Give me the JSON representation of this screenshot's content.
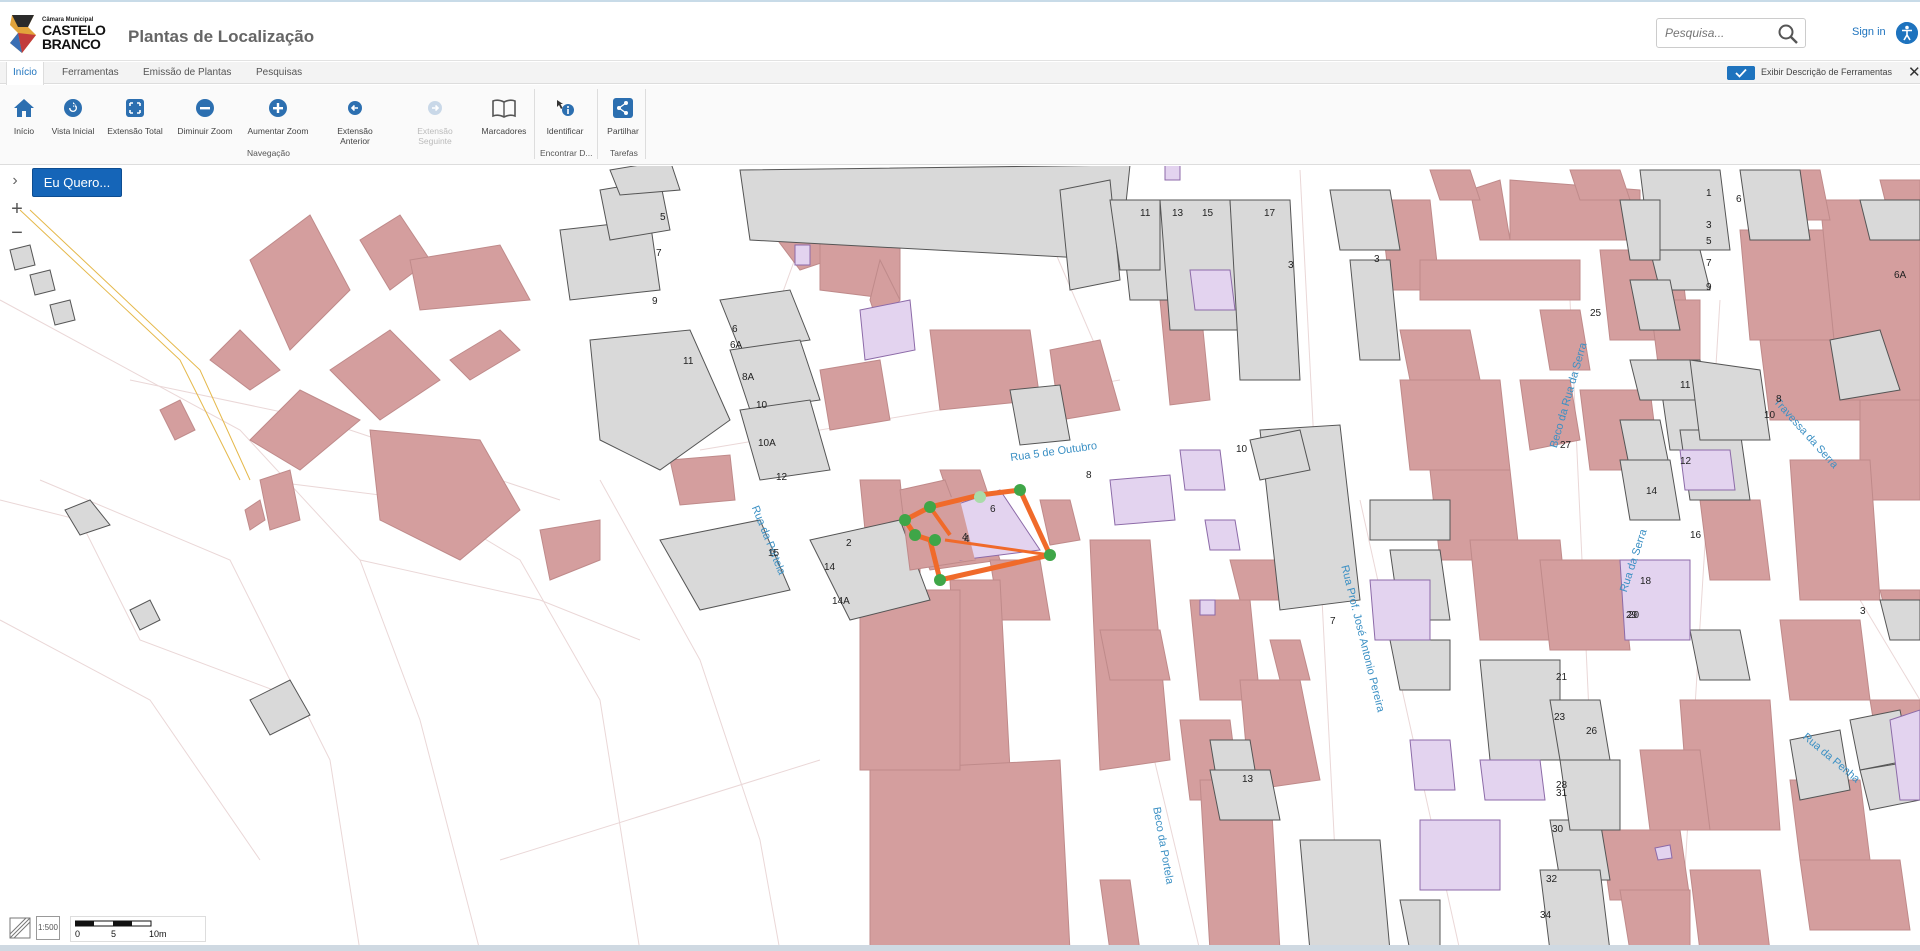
{
  "header": {
    "logo_small": "Câmara Municipal",
    "logo_line1": "CASTELO",
    "logo_line2": "BRANCO",
    "app_title": "Plantas de Localização",
    "search_placeholder": "Pesquisa...",
    "signin_label": "Sign in"
  },
  "tabs": [
    {
      "label": "Início",
      "active": true
    },
    {
      "label": "Ferramentas"
    },
    {
      "label": "Emissão de Plantas"
    },
    {
      "label": "Pesquisas"
    }
  ],
  "toggle_label": "Exibir Descrição de Ferramentas",
  "ribbon": {
    "buttons": [
      {
        "label": "Início",
        "icon": "home-icon"
      },
      {
        "label": "Vista Inicial",
        "icon": "refresh-icon"
      },
      {
        "label": "Extensão Total",
        "icon": "expand-icon"
      },
      {
        "label": "Diminuir Zoom",
        "icon": "minus-circle-icon"
      },
      {
        "label": "Aumentar Zoom",
        "icon": "plus-circle-icon"
      },
      {
        "label": "Extensão Anterior",
        "icon": "back-arrow-icon"
      },
      {
        "label": "Extensão Seguinte",
        "icon": "forward-arrow-icon",
        "disabled": true
      },
      {
        "label": "Marcadores",
        "icon": "book-icon"
      },
      {
        "label": "Identificar",
        "icon": "info-icon"
      },
      {
        "label": "Partilhar",
        "icon": "share-icon"
      }
    ],
    "groups": [
      "Navegação",
      "Encontrar D...",
      "Tarefas"
    ]
  },
  "map": {
    "eu_quero_label": "Eu Quero...",
    "scale_labels": [
      "0",
      "5",
      "10m"
    ],
    "scale_tool_label": "1:500",
    "street_labels": [
      "Rua 5 de Outubro",
      "Rua da Portela",
      "Beco da Portela",
      "Rua Prof. José Antonio Pereira",
      "Beco da Rua da Serra",
      "Rua da Serra",
      "Travessa da Serra",
      "Rua da Penha"
    ],
    "building_numbers": [
      "5",
      "7",
      "9",
      "11",
      "6",
      "6A",
      "8A",
      "10",
      "10A",
      "12",
      "11",
      "13",
      "15",
      "17",
      "3",
      "2",
      "14",
      "14A",
      "15",
      "4",
      "6",
      "8",
      "10",
      "1",
      "3",
      "5",
      "7",
      "9",
      "11",
      "13",
      "3",
      "7",
      "8",
      "10",
      "12",
      "14",
      "16",
      "18",
      "20",
      "21",
      "23",
      "25",
      "27",
      "28",
      "30",
      "31",
      "32",
      "34",
      "26",
      "29",
      "6",
      "6A",
      "3",
      "4"
    ]
  },
  "colors": {
    "accent": "#1e73be",
    "building_fill": "#d49e9e",
    "neutral_building": "#d9d9d9",
    "lilac_building": "#e3d3ef",
    "selection": "#f06a2a",
    "vertex": "#3fa648",
    "street_label": "#3b90c4"
  }
}
